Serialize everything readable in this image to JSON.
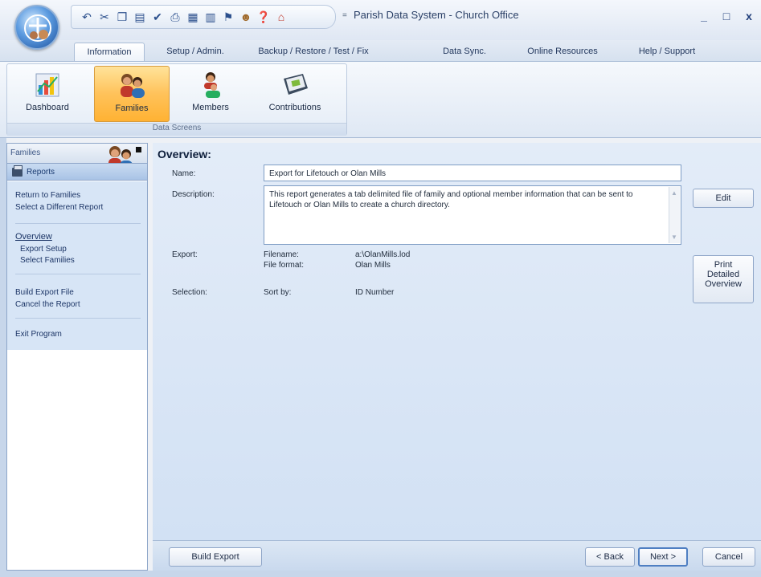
{
  "window": {
    "title": "Parish Data System - Church Office",
    "minimize_label": "_",
    "maximize_label": "□",
    "close_label": "x"
  },
  "quick_access": {
    "icons": [
      "undo-icon",
      "cut-icon",
      "copy-icon",
      "paste-icon",
      "spell-check-icon",
      "print-icon",
      "calculator-icon",
      "calendar-icon",
      "flag-icon",
      "user-icon",
      "help-icon",
      "home-icon"
    ],
    "more_label": "="
  },
  "tabs": [
    {
      "label": "Information",
      "active": true
    },
    {
      "label": "Setup / Admin."
    },
    {
      "label": "Backup / Restore / Test / Fix"
    },
    {
      "label": "Data Sync."
    },
    {
      "label": "Online Resources"
    },
    {
      "label": "Help / Support"
    }
  ],
  "ribbon": {
    "group_label": "Data Screens",
    "buttons": [
      {
        "label": "Dashboard",
        "icon": "dashboard-icon"
      },
      {
        "label": "Families",
        "icon": "families-icon",
        "active": true
      },
      {
        "label": "Members",
        "icon": "members-icon"
      },
      {
        "label": "Contributions",
        "icon": "contributions-icon"
      }
    ]
  },
  "sidebar": {
    "header": "Families",
    "section": "Reports",
    "links": {
      "return": "Return to Families",
      "select": "Select a Different Report",
      "overview": "Overview",
      "export_setup": "Export Setup",
      "select_families": "Select Families",
      "build": "Build Export File",
      "cancel": "Cancel the Report",
      "exit": "Exit Program"
    }
  },
  "overview": {
    "title": "Overview:",
    "name_label": "Name:",
    "name_value": "Export for Lifetouch or Olan Mills",
    "description_label": "Description:",
    "description_value": "This report generates a tab delimited file of family and optional member information that can be sent to Lifetouch or Olan Mills to create a church directory.",
    "export_label": "Export:",
    "filename_label": "Filename:",
    "filename_value": "a:\\OlanMills.lod",
    "format_label": "File format:",
    "format_value": "Olan Mills",
    "selection_label": "Selection:",
    "sortby_label": "Sort by:",
    "sortby_value": "ID Number",
    "edit_button": "Edit",
    "print_button_line1": "Print",
    "print_button_line2": "Detailed",
    "print_button_line3": "Overview"
  },
  "footer": {
    "build_export": "Build Export",
    "back": "< Back",
    "next": "Next >",
    "cancel": "Cancel"
  }
}
